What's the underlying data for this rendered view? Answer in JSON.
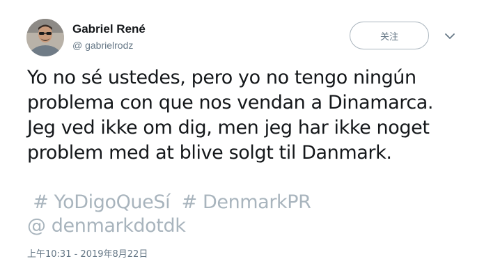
{
  "author": {
    "display_name": "Gabriel René",
    "handle": "@ gabrielrodz",
    "avatar_icon": "user-avatar"
  },
  "follow_button": {
    "label": "关注"
  },
  "more_icon": "chevron-down-icon",
  "tweet": {
    "lines": [
      "Yo no sé ustedes, pero yo no tengo ningún",
      "problema con que nos vendan a Dinamarca.",
      "Jeg ved ikke om dig, men jeg har ikke noget",
      "problem med at blive solgt til Danmark."
    ],
    "hashtags": [
      "# YoDigoQueSí",
      "# DenmarkPR"
    ],
    "mention": "@ denmarkdotdk"
  },
  "timestamp": "上午10:31 - 2019年8月22日",
  "colors": {
    "text": "#14171a",
    "secondary": "#657786",
    "link_muted": "#a8b4bd",
    "button_border": "#a9b4bd"
  }
}
